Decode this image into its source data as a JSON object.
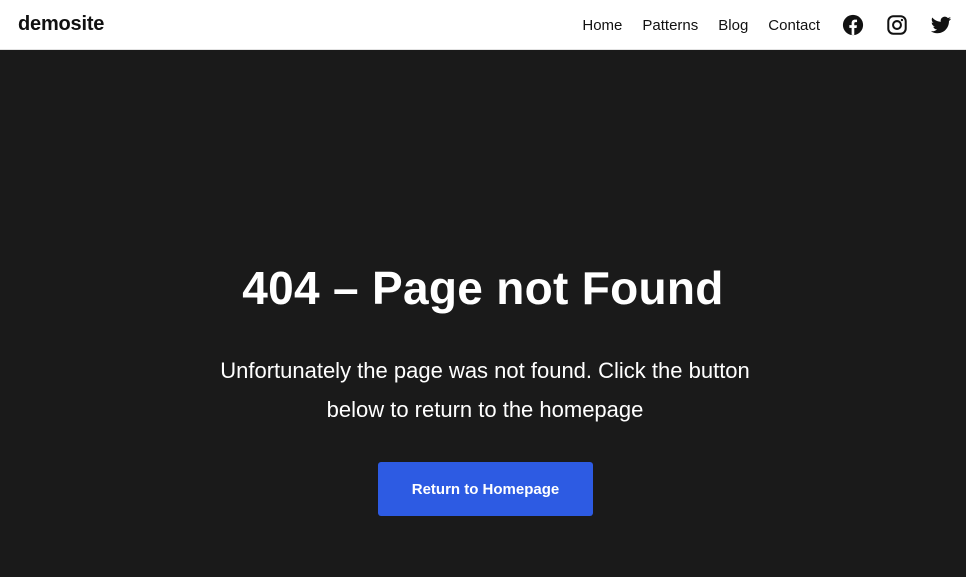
{
  "header": {
    "brand": "demosite",
    "nav": [
      {
        "label": "Home"
      },
      {
        "label": "Patterns"
      },
      {
        "label": "Blog"
      },
      {
        "label": "Contact"
      }
    ],
    "social": [
      {
        "icon": "facebook-icon"
      },
      {
        "icon": "instagram-icon"
      },
      {
        "icon": "twitter-icon"
      }
    ]
  },
  "main": {
    "title": "404 – Page not Found",
    "message_line1": "Unfortunately the page was not found. Click the button",
    "message_line2": "below to return to the homepage",
    "button_label": "Return to Homepage"
  },
  "colors": {
    "header_bg": "#ffffff",
    "hero_bg": "#1a1a1a",
    "button_bg": "#2d5be3",
    "text_dark": "#111111",
    "text_light": "#ffffff"
  }
}
